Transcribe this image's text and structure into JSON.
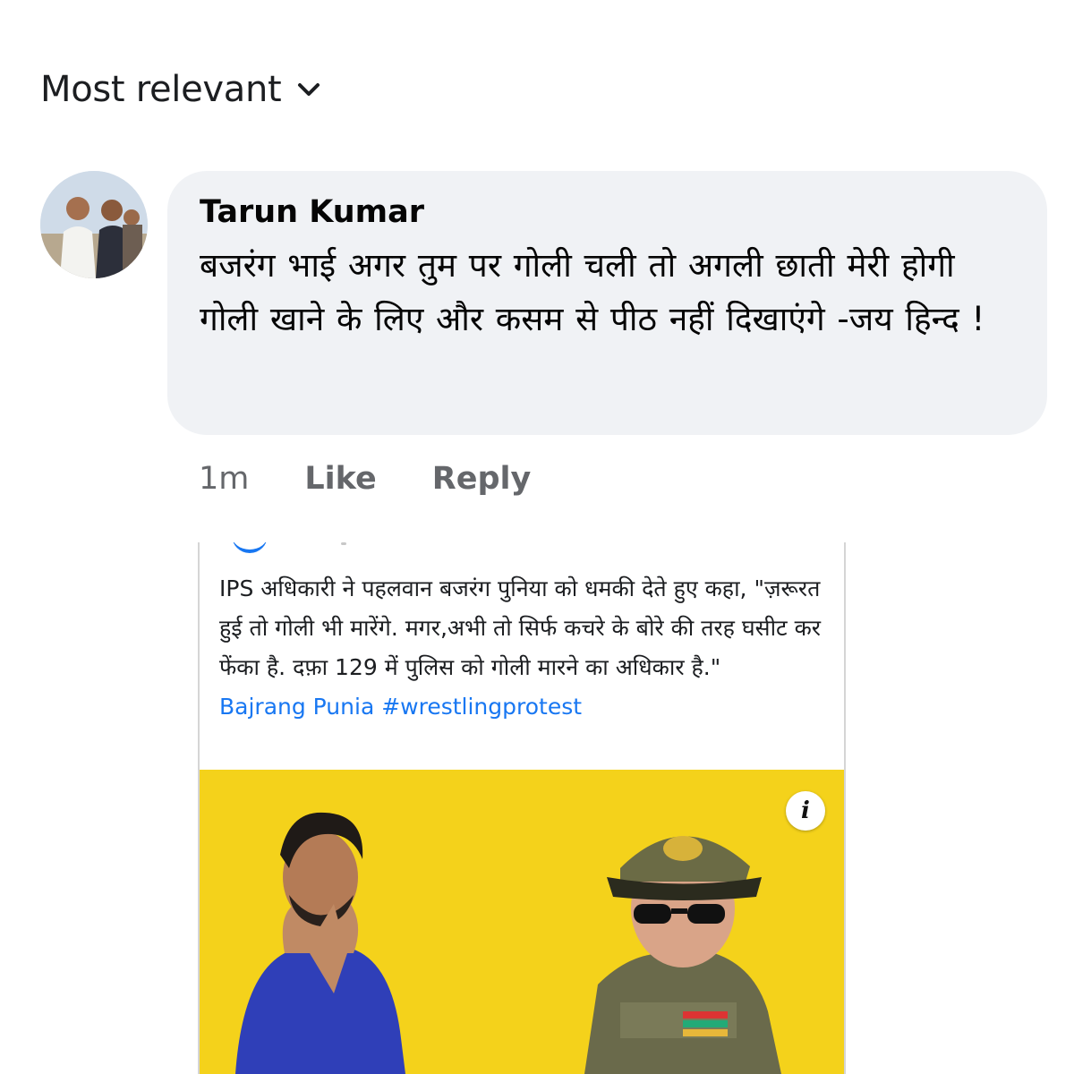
{
  "sort": {
    "label": "Most relevant",
    "chevron_icon": "chevron-down-icon"
  },
  "comment": {
    "author": "Tarun Kumar",
    "text": "बजरंग भाई अगर तुम पर गोली चली तो अगली छाती मेरी होगी गोली खाने के लिए और कसम से पीठ नहीं दिखाएंगे -जय हिन्द !",
    "avatar_icon": "profile-photo",
    "time": "1m",
    "like_label": "Like",
    "reply_label": "Reply"
  },
  "attachment": {
    "text": "IPS अधिकारी ने पहलवान बजरंग पुनिया को धमकी देते हुए कहा, \"ज़रूरत हुई तो गोली भी मारेंगे. मगर,अभी तो सिर्फ कचरे के बोरे की तरह घसीट कर फेंका है. दफ़ा 129 में पुलिस को गोली मारने का अधिकार है.\"",
    "tags": "Bajrang Punia #wrestlingprotest",
    "info_icon": "info-icon",
    "image_background": "#f4d21b"
  },
  "colors": {
    "bubble_bg": "#f0f2f5",
    "link": "#1877f2",
    "meta_text": "#65676b"
  }
}
